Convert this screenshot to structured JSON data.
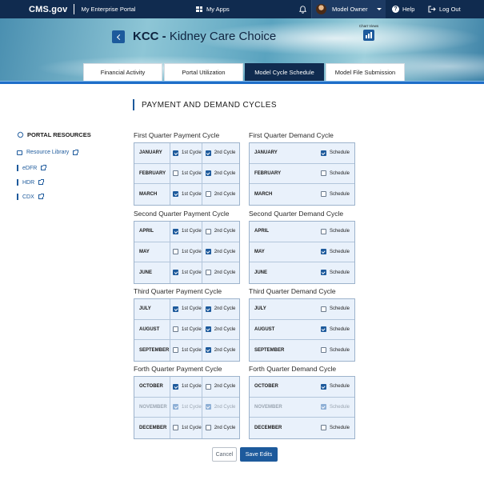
{
  "nav": {
    "brand": "CMS.gov",
    "portal": "My Enterprise Portal",
    "my_apps": "My Apps",
    "user": "Model Owner",
    "help": "Help",
    "logout": "Log Out"
  },
  "header": {
    "acronym": "KCC",
    "dash": " -",
    "model_name": "Kidney Care Choice",
    "chart_views": "Chart Views"
  },
  "tabs": [
    {
      "label": "Financial Activity",
      "active": false
    },
    {
      "label": "Portal Utilization",
      "active": false
    },
    {
      "label": "Model Cycle Schedule",
      "active": true
    },
    {
      "label": "Model File Submission",
      "active": false
    }
  ],
  "sidebar": {
    "title": "PORTAL RESOURCES",
    "items": [
      "Resource Library",
      "eDFR",
      "HDR",
      "CDX"
    ]
  },
  "page_title": "PAYMENT AND DEMAND CYCLES",
  "labels": {
    "cycle1": "1st Cycle",
    "cycle2": "2nd Cycle",
    "schedule": "Schedule"
  },
  "quarters": [
    {
      "payment_title": "First Quarter Payment Cycle",
      "demand_title": "First Quarter Demand Cycle",
      "months": [
        {
          "name": "JANUARY",
          "c1": true,
          "c2": true,
          "sched": true,
          "disabled": false
        },
        {
          "name": "FEBRUARY",
          "c1": false,
          "c2": true,
          "sched": false,
          "disabled": false
        },
        {
          "name": "MARCH",
          "c1": true,
          "c2": false,
          "sched": false,
          "disabled": false
        }
      ]
    },
    {
      "payment_title": "Second Quarter Payment Cycle",
      "demand_title": "Second Quarter Demand Cycle",
      "months": [
        {
          "name": "APRIL",
          "c1": true,
          "c2": false,
          "sched": false,
          "disabled": false
        },
        {
          "name": "MAY",
          "c1": false,
          "c2": true,
          "sched": true,
          "disabled": false
        },
        {
          "name": "JUNE",
          "c1": true,
          "c2": false,
          "sched": true,
          "disabled": false
        }
      ]
    },
    {
      "payment_title": "Third Quarter Payment Cycle",
      "demand_title": "Third Quarter Demand Cycle",
      "months": [
        {
          "name": "JULY",
          "c1": true,
          "c2": true,
          "sched": false,
          "disabled": false
        },
        {
          "name": "AUGUST",
          "c1": false,
          "c2": true,
          "sched": true,
          "disabled": false
        },
        {
          "name": "SEPTEMBER",
          "c1": false,
          "c2": true,
          "sched": false,
          "disabled": false
        }
      ]
    },
    {
      "payment_title": "Forth Quarter Payment Cycle",
      "demand_title": "Forth Quarter Demand Cycle",
      "months": [
        {
          "name": "OCTOBER",
          "c1": true,
          "c2": false,
          "sched": true,
          "disabled": false
        },
        {
          "name": "NOVEMBER",
          "c1": true,
          "c2": true,
          "sched": true,
          "disabled": true
        },
        {
          "name": "DECEMBER",
          "c1": false,
          "c2": false,
          "sched": false,
          "disabled": false
        }
      ]
    }
  ],
  "actions": {
    "cancel": "Cancel",
    "save": "Save Edits"
  },
  "colors": {
    "navy": "#102b4f",
    "accent": "#1d5a9c",
    "panel": "#e9f1fb"
  }
}
